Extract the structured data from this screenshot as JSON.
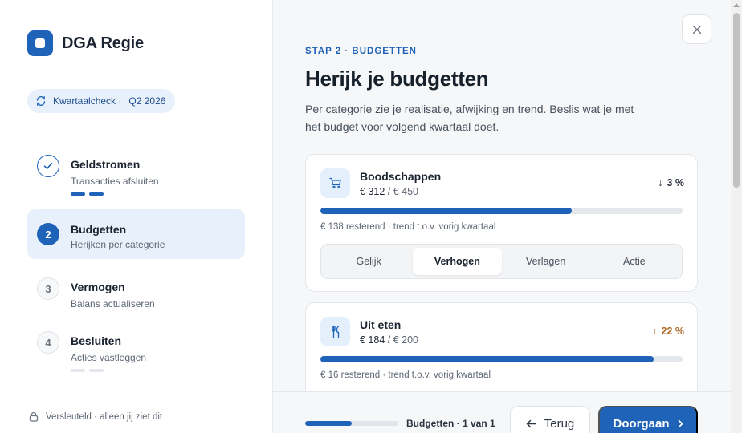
{
  "app": {
    "name": "DGA Regie"
  },
  "pill": {
    "label": "Kwartaalcheck ·",
    "period": "Q2 2026",
    "icon": "refresh-icon"
  },
  "steps": [
    {
      "number": "✓",
      "title": "Geldstromen",
      "subtitle": "Transacties afsluiten",
      "state": "done"
    },
    {
      "number": "2",
      "title": "Budgetten",
      "subtitle": "Herijken per categorie",
      "state": "current"
    },
    {
      "number": "3",
      "title": "Vermogen",
      "subtitle": "Balans actualiseren",
      "state": "todo"
    },
    {
      "number": "4",
      "title": "Besluiten",
      "subtitle": "Acties vastleggen",
      "state": "todo"
    }
  ],
  "sidebar_footer": "Versleuteld · alleen jij ziet dit",
  "main": {
    "eyebrow": "STAP 2 · BUDGETTEN",
    "title": "Herijk je budgetten",
    "intro": "Per categorie zie je realisatie, afwijking en trend. Beslis wat je met het budget voor volgend kwartaal doet."
  },
  "budgets": [
    {
      "name": "Boodschappen",
      "spent": "€ 312",
      "budget": "/ € 450",
      "trend_arrow": "↓",
      "trend": "3 %",
      "trend_direction": "down",
      "fill_fraction": 0.693,
      "note": "€ 138 resterend · trend t.o.v. vorig kwartaal",
      "icon": "cart-icon",
      "options": [
        "Gelijk",
        "Verhogen",
        "Verlagen",
        "Actie"
      ],
      "selected_option": "Verhogen"
    },
    {
      "name": "Uit eten",
      "spent": "€ 184",
      "budget": "/ € 200",
      "trend_arrow": "↑",
      "trend": "22 %",
      "trend_direction": "up",
      "fill_fraction": 0.92,
      "note": "€ 16 resterend · trend t.o.v. vorig kwartaal",
      "icon": "cutlery-icon"
    }
  ],
  "footer": {
    "progress_fraction": 0.5,
    "progress_label": "Budgetten",
    "progress_count": "· 1 van 1",
    "back_label": "Terug",
    "next_label": "Doorgaan"
  },
  "colors": {
    "accent": "#1f63b8",
    "accent_light": "#e8f1fb",
    "trend_up": "#b0692a"
  }
}
